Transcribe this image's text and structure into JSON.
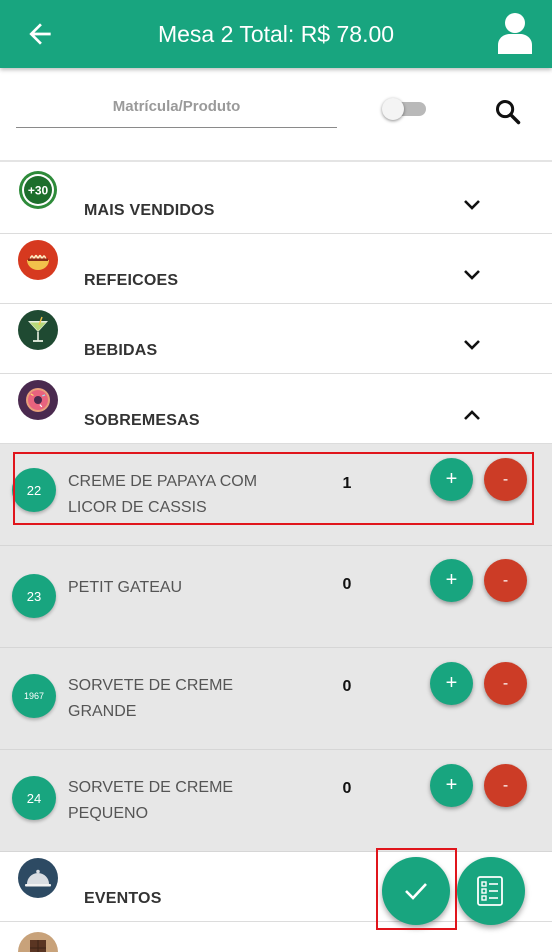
{
  "header": {
    "title": "Mesa 2 Total: R$ 78.00",
    "back_icon": "arrow-left-icon",
    "user_icon": "user-icon"
  },
  "search": {
    "placeholder": "Matrícula/Produto",
    "toggle_on": false,
    "search_icon": "search-icon"
  },
  "categories": [
    {
      "label": "MAIS VENDIDOS",
      "icon": "plus-30-icon",
      "expanded": false
    },
    {
      "label": "REFEICOES",
      "icon": "noodle-bowl-icon",
      "expanded": false
    },
    {
      "label": "BEBIDAS",
      "icon": "cocktail-glass-icon",
      "expanded": false
    },
    {
      "label": "SOBREMESAS",
      "icon": "donut-icon",
      "expanded": true
    },
    {
      "label": "EVENTOS",
      "icon": "cloche-icon",
      "expanded": false
    }
  ],
  "items": [
    {
      "code": "22",
      "name_line1": "CREME DE PAPAYA COM",
      "name_line2": "LICOR DE CASSIS",
      "qty": "1",
      "plus": "+",
      "minus": "-"
    },
    {
      "code": "23",
      "name_line1": "PETIT GATEAU",
      "name_line2": "",
      "qty": "0",
      "plus": "+",
      "minus": "-"
    },
    {
      "code": "1967",
      "name_line1": "SORVETE DE CREME",
      "name_line2": "GRANDE",
      "qty": "0",
      "plus": "+",
      "minus": "-"
    },
    {
      "code": "24",
      "name_line1": "SORVETE DE CREME",
      "name_line2": "PEQUENO",
      "qty": "0",
      "plus": "+",
      "minus": "-"
    }
  ],
  "actions": {
    "confirm_icon": "check-icon",
    "checklist_icon": "checklist-icon"
  },
  "colors": {
    "primary": "#18a57f",
    "danger": "#cc3c26",
    "highlight": "#e0151c"
  }
}
